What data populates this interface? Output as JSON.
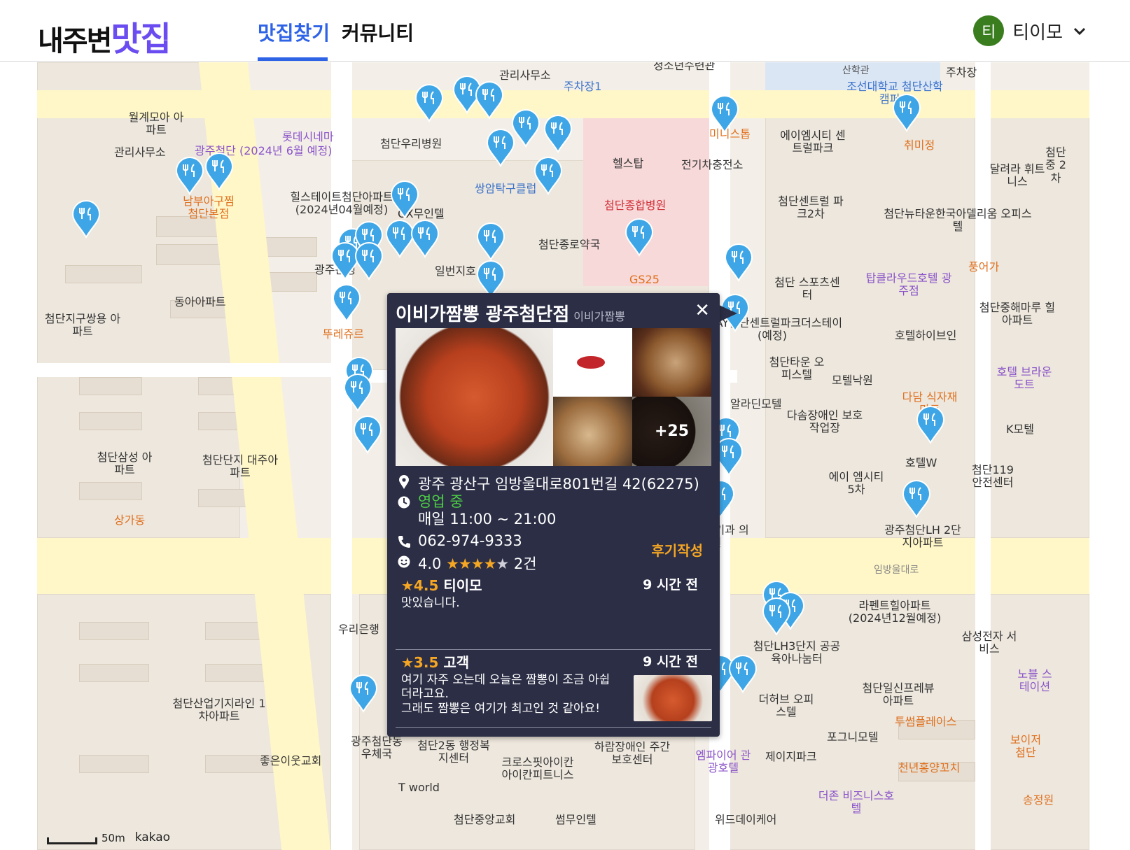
{
  "header": {
    "logo_part1": "내주변",
    "logo_part2": "맛집",
    "tabs": [
      {
        "label": "맛집찾기",
        "active": true
      },
      {
        "label": "커뮤니티",
        "active": false
      }
    ],
    "user": {
      "avatar_initial": "티",
      "name": "티이모",
      "avatar_color": "#3a7d1f"
    },
    "accent_color": "#2f63e6",
    "logo_color": "#6a4cf0"
  },
  "map": {
    "labels": [
      "청소년수련관",
      "관리사무소",
      "주차장1",
      "산학관",
      "조선대학교 첨단산학캠퍼스",
      "주차장",
      "월계모아 아파트",
      "관리사무소",
      "롯데시네마",
      "광주첨단 (2024년 6월 예정)",
      "첨단우리병원",
      "미니스톱",
      "에이엠시티 센트럴파크",
      "취미정",
      "첨단중 2차",
      "남부아구찜 첨단본점",
      "힐스테이트첨단아파트 (2024년04월예정)",
      "쌍암탁구클럽",
      "헬스탑",
      "전기차충전소",
      "첨단종합병원",
      "첨단센트럴 파크2차",
      "달려라 휘트니스",
      "OX무인텔",
      "첨단뉴타운한국아델리움 오피스텔",
      "첨단종로약국",
      "일번지호",
      "광주은행",
      "GS25",
      "첨단 스포츠센터",
      "탑클라우드호텔 광주점",
      "풍어가",
      "첨단중해마루 힐아파트",
      "동아아파트",
      "첨단지구쌍용 아파트",
      "뚜레쥬르",
      "STAY첨단센트럴파크더스테이 (예정)",
      "호텔하이브인",
      "첨단타운 오피스텔",
      "모텔낙원",
      "호텔 브라운도트",
      "다담 식자재마트",
      "알라딘모텔",
      "다솜장애인 보호작업장",
      "K모텔",
      "첨단삼성 아파트",
      "첨단단지 대주아파트",
      "호텔W",
      "에이 엠시티5차",
      "첨단119 안전센터",
      "상가동",
      "광주첨단LH 2단지아파트",
      "임방울대로",
      "라펜트힐아파트 (2024년12월예정)",
      "삼성전자 서비스",
      "우리은행",
      "첨단LH3단지 공공육아나눔터",
      "더허브 오피스텔",
      "첨단일신프레뷰 아파트",
      "노블 스테이션",
      "투썸플레이스",
      "첨단산업기지라인 1차아파트",
      "광주첨단동 우체국",
      "첨단2동 행정복지센터",
      "크로스핏아이칸 아이칸피트니스",
      "하람장애인 주간보호센터",
      "엠파이어 관광호텔",
      "제이지파크",
      "포그니모텔",
      "보이저 첨단",
      "천년홍양꼬치",
      "더존 비즈니스호텔",
      "좋은이웃교회",
      "T world",
      "첨단중앙교회",
      "썸무인텔",
      "위드데이케어",
      "송정원",
      "본점",
      "뉴비뇨기과 의원"
    ],
    "scale_label": "50m",
    "brand": "kakao",
    "pin_color": "#3ea6e6"
  },
  "popup": {
    "name": "이비가짬뽕 광주첨단점",
    "category": "이비가짬뽕",
    "close_icon": "close-icon",
    "more_photos": "+25",
    "address": "광주 광산구 임방울대로801번길 42(62275)",
    "status": "영업 중",
    "hours": "매일 11:00 ~ 21:00",
    "phone": "062-974-9333",
    "rating": "4.0",
    "rating_value": 4.0,
    "stars_filled": "★★★★",
    "stars_empty": "★",
    "review_count": "2건",
    "write_review": "후기작성",
    "reviews": [
      {
        "score": "★4.5",
        "author": "티이모",
        "time": "9 시간 전",
        "text": "맛있습니다."
      },
      {
        "score": "★3.5",
        "author": "고객",
        "time": "9 시간 전",
        "text": "여기 자주 오는데 오늘은 짬뽕이 조금 아쉽더라고요.\n그래도 짬뽕은 여기가 최고인 것 같아요!"
      }
    ]
  }
}
